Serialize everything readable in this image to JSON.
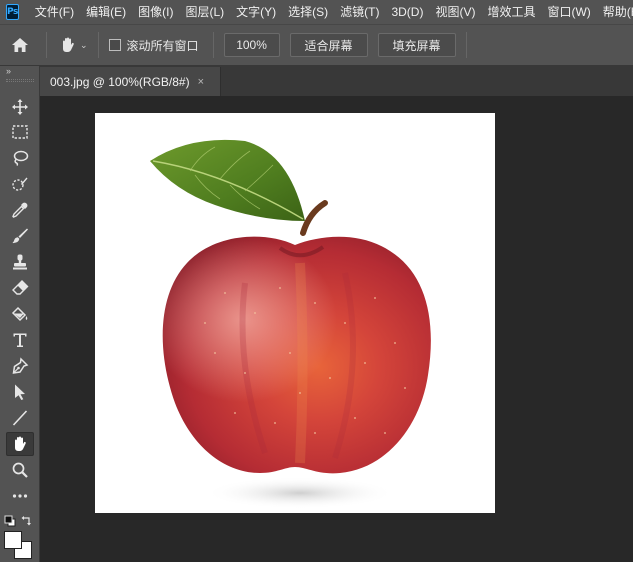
{
  "app": {
    "logo": "Ps"
  },
  "menu": [
    "文件(F)",
    "编辑(E)",
    "图像(I)",
    "图层(L)",
    "文字(Y)",
    "选择(S)",
    "滤镜(T)",
    "3D(D)",
    "视图(V)",
    "增效工具",
    "窗口(W)",
    "帮助(H)"
  ],
  "options": {
    "scroll_all_label": "滚动所有窗口",
    "zoom_label": "100%",
    "fit_screen_label": "适合屏幕",
    "fill_screen_label": "填充屏幕"
  },
  "document": {
    "tab_label": "003.jpg @ 100%(RGB/8#)",
    "close_glyph": "×"
  },
  "toolbar": {
    "collapse_glyph": "››",
    "tools": [
      "move",
      "marquee",
      "lasso",
      "quick-select",
      "eyedropper",
      "brush",
      "clone-stamp",
      "eraser",
      "gradient",
      "text",
      "pen",
      "path-select",
      "line",
      "hand",
      "zoom",
      "more"
    ],
    "active_tool": "hand"
  },
  "colors": {
    "chrome": "#535353",
    "workspace": "#282828",
    "foreground": "#ffffff",
    "background": "#ffffff"
  }
}
